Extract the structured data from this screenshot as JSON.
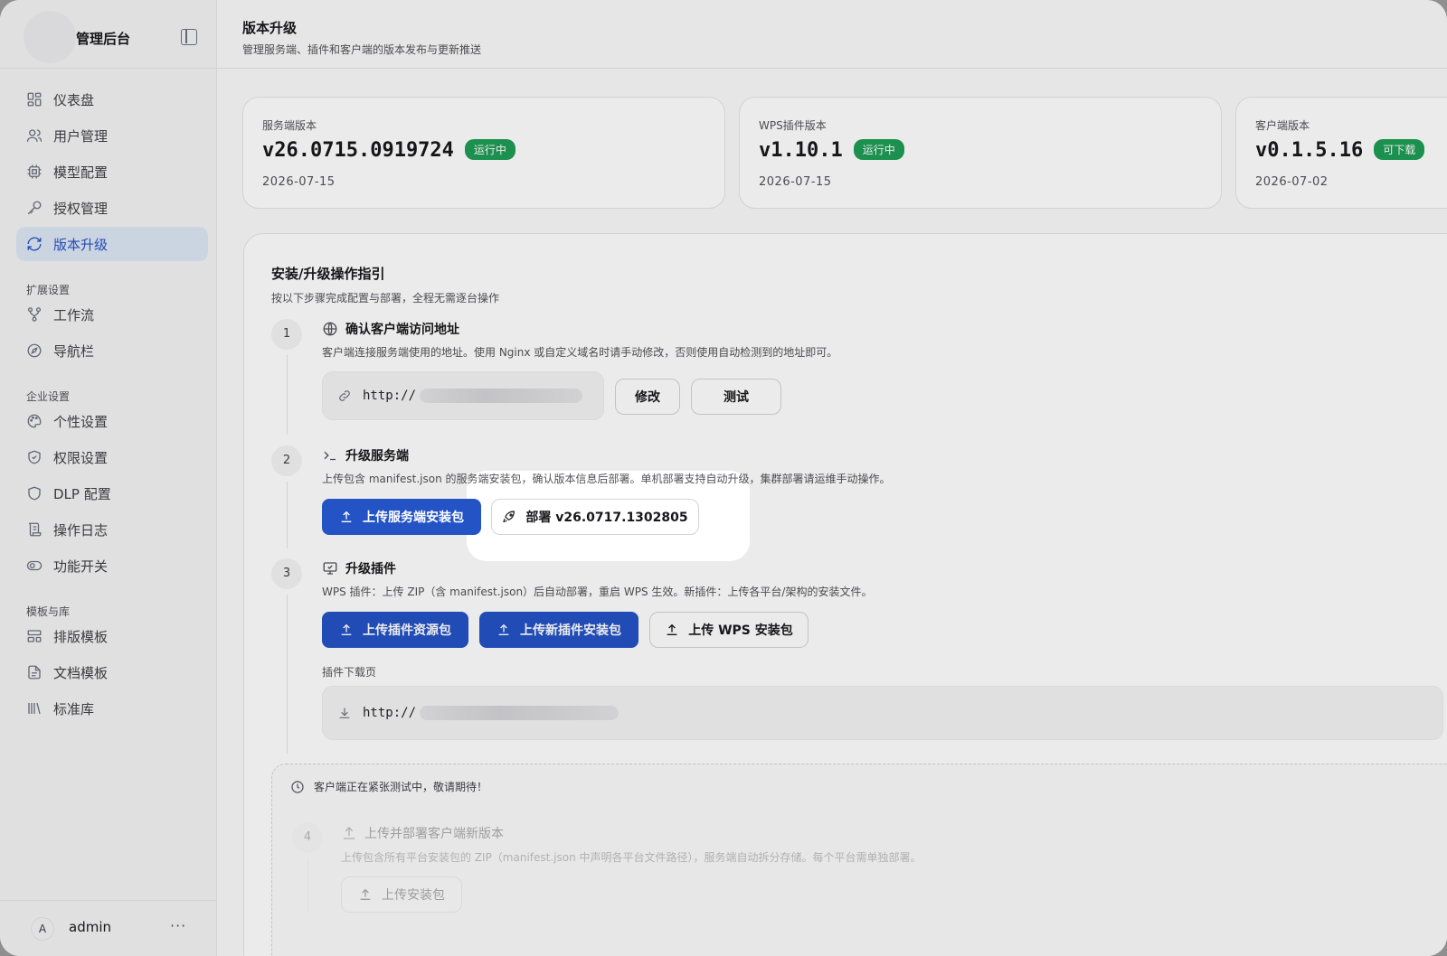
{
  "brand": {
    "title": "管理后台"
  },
  "nav": {
    "main": [
      {
        "label": "仪表盘",
        "icon": "dashboard-icon"
      },
      {
        "label": "用户管理",
        "icon": "users-icon"
      },
      {
        "label": "模型配置",
        "icon": "cpu-icon"
      },
      {
        "label": "授权管理",
        "icon": "key-icon"
      },
      {
        "label": "版本升级",
        "icon": "refresh-icon",
        "active": true
      }
    ],
    "groups": [
      {
        "title": "扩展设置",
        "items": [
          {
            "label": "工作流",
            "icon": "workflow-icon"
          },
          {
            "label": "导航栏",
            "icon": "compass-icon"
          }
        ]
      },
      {
        "title": "企业设置",
        "items": [
          {
            "label": "个性设置",
            "icon": "palette-icon"
          },
          {
            "label": "权限设置",
            "icon": "shield-check-icon"
          },
          {
            "label": "DLP 配置",
            "icon": "shield-icon"
          },
          {
            "label": "操作日志",
            "icon": "scroll-icon"
          },
          {
            "label": "功能开关",
            "icon": "toggle-icon"
          }
        ]
      },
      {
        "title": "模板与库",
        "items": [
          {
            "label": "排版模板",
            "icon": "layout-icon"
          },
          {
            "label": "文档模板",
            "icon": "file-text-icon"
          },
          {
            "label": "标准库",
            "icon": "library-icon"
          }
        ]
      }
    ]
  },
  "user": {
    "avatar": "A",
    "name": "admin",
    "more": "···"
  },
  "header": {
    "title": "版本升级",
    "subtitle": "管理服务端、插件和客户端的版本发布与更新推送"
  },
  "versions": [
    {
      "label": "服务端版本",
      "version": "v26.0715.0919724",
      "badge": "运行中",
      "date": "2026-07-15"
    },
    {
      "label": "WPS插件版本",
      "version": "v1.10.1",
      "badge": "运行中",
      "date": "2026-07-15"
    },
    {
      "label": "客户端版本",
      "version": "v0.1.5.16",
      "badge": "可下载",
      "date": "2026-07-02"
    }
  ],
  "guide": {
    "title": "安装/升级操作指引",
    "subtitle": "按以下步骤完成配置与部署，全程无需逐台操作",
    "step1": {
      "num": "1",
      "title": "确认客户端访问地址",
      "desc": "客户端连接服务端使用的地址。使用 Nginx 或自定义域名时请手动修改，否则使用自动检测到的地址即可。",
      "url_prefix": "http://",
      "edit": "修改",
      "test": "测试"
    },
    "step2": {
      "num": "2",
      "title": "升级服务端",
      "desc": "上传包含 manifest.json 的服务端安装包，确认版本信息后部署。单机部署支持自动升级，集群部署请运维手动操作。",
      "upload": "上传服务端安装包",
      "deploy": "部署 v26.0717.1302805"
    },
    "step3": {
      "num": "3",
      "title": "升级插件",
      "desc": "WPS 插件：上传 ZIP（含 manifest.json）后自动部署，重启 WPS 生效。新插件：上传各平台/架构的安装文件。",
      "upload_res": "上传插件资源包",
      "upload_new": "上传新插件安装包",
      "upload_wps": "上传 WPS 安装包",
      "download_label": "插件下载页",
      "download_url_prefix": "http://"
    },
    "upcoming": {
      "notice": "客户端正在紧张测试中，敬请期待！",
      "num": "4",
      "title": "上传并部署客户端新版本",
      "desc": "上传包含所有平台安装包的 ZIP（manifest.json 中声明各平台文件路径），服务端自动拆分存储。每个平台需单独部署。",
      "button": "上传安装包"
    }
  }
}
